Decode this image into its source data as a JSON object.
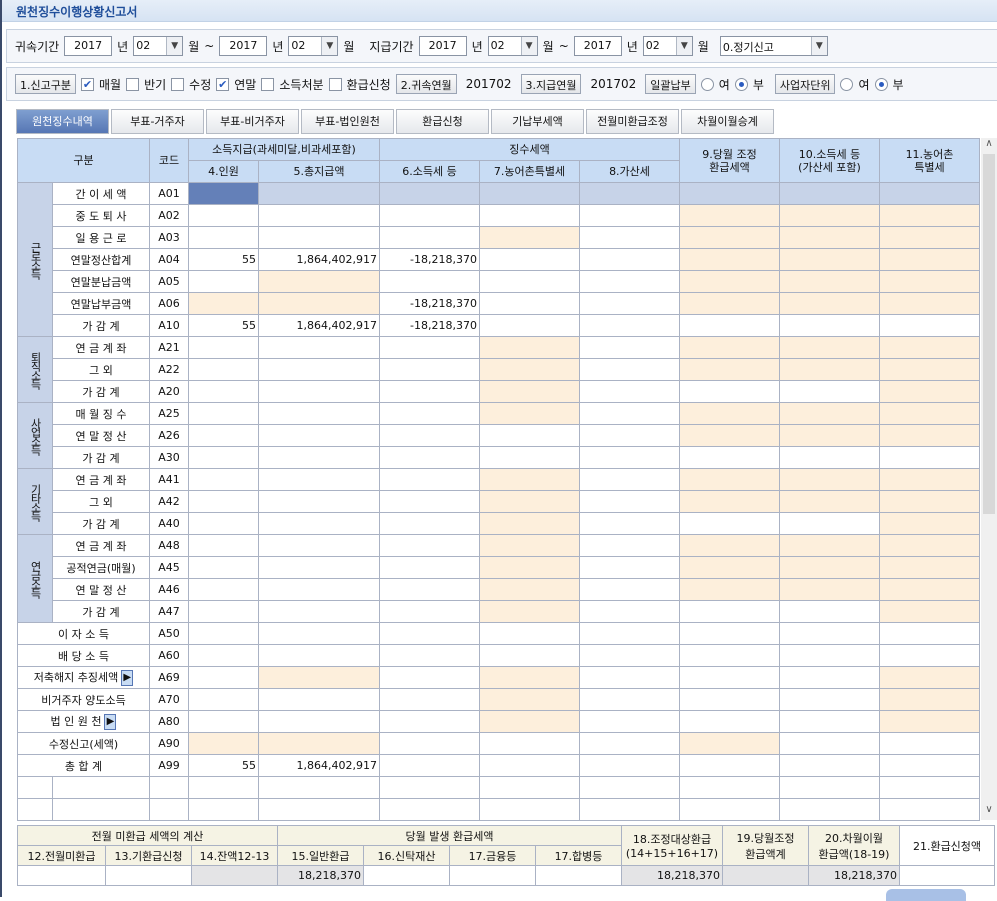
{
  "title": "원천징수이행상황신고서",
  "filter": {
    "belong_label": "귀속기간",
    "belong_from_year": "2017",
    "year_unit": "년",
    "belong_from_month": "02",
    "month_unit": "월",
    "tilde": "~",
    "belong_to_year": "2017",
    "belong_to_month": "02",
    "pay_label": "지급기간",
    "pay_from_year": "2017",
    "pay_from_month": "02",
    "pay_to_year": "2017",
    "pay_to_month": "02",
    "report_type": "0.정기신고"
  },
  "options": {
    "report_kind_btn": "1.신고구분",
    "monthly": "매월",
    "monthly_checked": true,
    "half": "반기",
    "half_checked": false,
    "amend": "수정",
    "amend_checked": false,
    "yearend": "연말",
    "yearend_checked": true,
    "disposal": "소득처분",
    "disposal_checked": false,
    "refund": "환급신청",
    "refund_checked": false,
    "belong_ym_btn": "2.귀속연월",
    "belong_ym": "201702",
    "pay_ym_btn": "3.지급연월",
    "pay_ym": "201702",
    "lump_btn": "일괄납부",
    "yes": "여",
    "no": "부",
    "lump_value": "부",
    "unit_btn": "사업자단위",
    "unit_value": "부"
  },
  "tabs": [
    "원천징수내역",
    "부표-거주자",
    "부표-비거주자",
    "부표-법인원천",
    "환급신청",
    "기납부세액",
    "전월미환급조정",
    "차월이월승계"
  ],
  "header": {
    "category": "구분",
    "code": "코드",
    "income_pay": "소득지급(과세미달,비과세포함)",
    "tax_collected": "징수세액",
    "c4": "4.인원",
    "c5": "5.총지급액",
    "c6": "6.소득세 등",
    "c7": "7.농어촌특별세",
    "c8": "8.가산세",
    "c9a": "9.당월 조정",
    "c9b": "환급세액",
    "c10a": "10.소득세 등",
    "c10b": "(가산세 포함)",
    "c11a": "11.농어촌",
    "c11b": "특별세"
  },
  "groups": [
    {
      "label": "근로소득",
      "span": 7
    },
    {
      "label": "퇴직소득",
      "span": 3
    },
    {
      "label": "사업소득",
      "span": 3
    },
    {
      "label": "기타소득",
      "span": 3
    },
    {
      "label": "연금소득",
      "span": 4
    }
  ],
  "rows": [
    {
      "label": "간 이 세 액",
      "code": "A01",
      "values": [
        "",
        "",
        "",
        "",
        "",
        "",
        "",
        ""
      ],
      "shade": "dggggggg"
    },
    {
      "label": "중 도 퇴 사",
      "code": "A02",
      "values": [
        "",
        "",
        "",
        "",
        "",
        "",
        "",
        ""
      ],
      "shade": "wwwwwppp"
    },
    {
      "label": "일 용 근 로",
      "code": "A03",
      "values": [
        "",
        "",
        "",
        "",
        "",
        "",
        "",
        ""
      ],
      "shade": "wwwpwppp"
    },
    {
      "label": "연말정산합계",
      "code": "A04",
      "values": [
        "55",
        "1,864,402,917",
        "-18,218,370",
        "",
        "",
        "",
        "",
        ""
      ],
      "shade": "wwwwwppp"
    },
    {
      "label": "연말분납금액",
      "code": "A05",
      "values": [
        "",
        "",
        "",
        "",
        "",
        "",
        "",
        ""
      ],
      "shade": "wpwwwppp"
    },
    {
      "label": "연말납부금액",
      "code": "A06",
      "values": [
        "",
        "",
        "-18,218,370",
        "",
        "",
        "",
        "",
        ""
      ],
      "shade": "ppwwwppp"
    },
    {
      "label": "가 감 계",
      "code": "A10",
      "values": [
        "55",
        "1,864,402,917",
        "-18,218,370",
        "",
        "",
        "",
        "",
        ""
      ],
      "shade": "wwwwwwww"
    },
    {
      "label": "연 금 계 좌",
      "code": "A21",
      "values": [
        "",
        "",
        "",
        "",
        "",
        "",
        "",
        ""
      ],
      "shade": "wwwpwppp"
    },
    {
      "label": "그 외",
      "code": "A22",
      "values": [
        "",
        "",
        "",
        "",
        "",
        "",
        "",
        ""
      ],
      "shade": "wwwpwppp"
    },
    {
      "label": "가 감 계",
      "code": "A20",
      "values": [
        "",
        "",
        "",
        "",
        "",
        "",
        "",
        ""
      ],
      "shade": "wwwpwwwp"
    },
    {
      "label": "매 월 징 수",
      "code": "A25",
      "values": [
        "",
        "",
        "",
        "",
        "",
        "",
        "",
        ""
      ],
      "shade": "wwwpwppp"
    },
    {
      "label": "연 말 정 산",
      "code": "A26",
      "values": [
        "",
        "",
        "",
        "",
        "",
        "",
        "",
        ""
      ],
      "shade": "wwwwwppp"
    },
    {
      "label": "가 감 계",
      "code": "A30",
      "values": [
        "",
        "",
        "",
        "",
        "",
        "",
        "",
        ""
      ],
      "shade": "wwwwwwww"
    },
    {
      "label": "연 금 계 좌",
      "code": "A41",
      "values": [
        "",
        "",
        "",
        "",
        "",
        "",
        "",
        ""
      ],
      "shade": "wwwpwppp"
    },
    {
      "label": "그 외",
      "code": "A42",
      "values": [
        "",
        "",
        "",
        "",
        "",
        "",
        "",
        ""
      ],
      "shade": "wwwpwppp"
    },
    {
      "label": "가 감 계",
      "code": "A40",
      "values": [
        "",
        "",
        "",
        "",
        "",
        "",
        "",
        ""
      ],
      "shade": "wwwpwwwp"
    },
    {
      "label": "연 금 계 좌",
      "code": "A48",
      "values": [
        "",
        "",
        "",
        "",
        "",
        "",
        "",
        ""
      ],
      "shade": "wwwpwppp"
    },
    {
      "label": "공적연금(매월)",
      "code": "A45",
      "values": [
        "",
        "",
        "",
        "",
        "",
        "",
        "",
        ""
      ],
      "shade": "wwwpwppp"
    },
    {
      "label": "연 말 정 산",
      "code": "A46",
      "values": [
        "",
        "",
        "",
        "",
        "",
        "",
        "",
        ""
      ],
      "shade": "wwwpwppp"
    },
    {
      "label": "가 감 계",
      "code": "A47",
      "values": [
        "",
        "",
        "",
        "",
        "",
        "",
        "",
        ""
      ],
      "shade": "wwwpwwwp"
    },
    {
      "label": "이 자 소 득",
      "code": "A50",
      "values": [
        "",
        "",
        "",
        "",
        "",
        "",
        "",
        ""
      ],
      "shade": "wwwwwwww"
    },
    {
      "label": "배 당 소 득",
      "code": "A60",
      "values": [
        "",
        "",
        "",
        "",
        "",
        "",
        "",
        ""
      ],
      "shade": "wwwwwwww"
    },
    {
      "label": "저축해지 추징세액",
      "code": "A69",
      "values": [
        "",
        "",
        "",
        "",
        "",
        "",
        "",
        ""
      ],
      "shade": "wpwpwwwp",
      "arrow": true
    },
    {
      "label": "비거주자 양도소득",
      "code": "A70",
      "values": [
        "",
        "",
        "",
        "",
        "",
        "",
        "",
        ""
      ],
      "shade": "wwwpwwwp"
    },
    {
      "label": "법 인 원 천",
      "code": "A80",
      "values": [
        "",
        "",
        "",
        "",
        "",
        "",
        "",
        ""
      ],
      "shade": "wwwpwwwp",
      "arrow": true
    },
    {
      "label": "수정신고(세액)",
      "code": "A90",
      "values": [
        "",
        "",
        "",
        "",
        "",
        "",
        "",
        ""
      ],
      "shade": "ppwwwpww"
    },
    {
      "label": "총 합 계",
      "code": "A99",
      "values": [
        "55",
        "1,864,402,917",
        "",
        "",
        "",
        "",
        "",
        ""
      ],
      "shade": "wwwwwwww"
    }
  ],
  "bottom": {
    "prev_group": "전월 미환급 세액의 계산",
    "curr_group": "당월 발생 환급세액",
    "h12": "12.전월미환급",
    "h13": "13.기환급신청",
    "h14": "14.잔액12-13",
    "h15": "15.일반환급",
    "h16": "16.신탁재산",
    "h17a": "17.금융등",
    "h17b": "17.합병등",
    "h18a": "18.조정대상환급",
    "h18b": "(14+15+16+17)",
    "h19a": "19.당월조정",
    "h19b": "환급액계",
    "h20a": "20.차월이월",
    "h20b": "환급액(18-19)",
    "h21": "21.환급신청액",
    "values": [
      "",
      "",
      "",
      "18,218,370",
      "",
      "",
      "",
      "18,218,370",
      "",
      "18,218,370",
      ""
    ]
  }
}
